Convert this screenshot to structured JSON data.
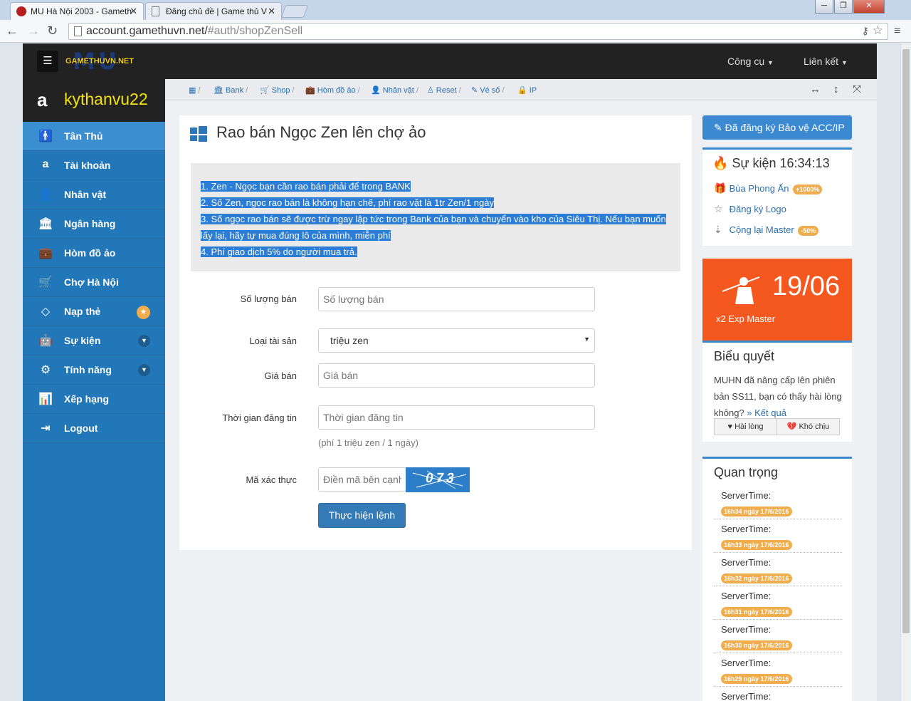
{
  "browser": {
    "tabs": [
      {
        "title": "MU Hà Nội 2003 - Gameth",
        "active": true
      },
      {
        "title": "Đăng chủ đề | Game thủ V",
        "active": false
      }
    ],
    "url_main": "account.gamethuvn.net/",
    "url_rest": "#auth/shopZenSell",
    "window_buttons": [
      "─",
      "❐",
      "✕"
    ]
  },
  "header": {
    "logo_big": "MU",
    "logo_small": "GAMETHUVN.NET",
    "menu": [
      "Công cụ",
      "Liên kết"
    ]
  },
  "user": {
    "name": "kythanvu22"
  },
  "sidebar": {
    "items": [
      {
        "label": "Tân Thủ",
        "icon": "child-icon",
        "glyph": "🚹"
      },
      {
        "label": "Tài khoản",
        "icon": "amazon-icon",
        "glyph": "a"
      },
      {
        "label": "Nhân vật",
        "icon": "user-icon",
        "glyph": "👤"
      },
      {
        "label": "Ngân hàng",
        "icon": "bank-icon",
        "glyph": "🏛"
      },
      {
        "label": "Hòm đồ ảo",
        "icon": "briefcase-icon",
        "glyph": "💼"
      },
      {
        "label": "Chợ Hà Nội",
        "icon": "cart-icon",
        "glyph": "🛒"
      },
      {
        "label": "Nạp thẻ",
        "icon": "diamond-icon",
        "glyph": "◇"
      },
      {
        "label": "Sự kiện",
        "icon": "android-icon",
        "glyph": "🤖"
      },
      {
        "label": "Tính năng",
        "icon": "cogs-icon",
        "glyph": "⚙"
      },
      {
        "label": "Xếp hạng",
        "icon": "bar-chart-icon",
        "glyph": "📊"
      },
      {
        "label": "Logout",
        "icon": "sign-out-icon",
        "glyph": "⇥"
      }
    ]
  },
  "breadcrumb": {
    "items": [
      "Bank",
      "Shop",
      "Hòm đồ ảo",
      "Nhân vật",
      "Reset",
      "Vé số",
      "IP"
    ]
  },
  "main": {
    "title": "Rao bán Ngọc Zen lên chợ ảo",
    "notice_lines": [
      "1. Zen - Ngọc bạn cần rao bán phải để trong BANK",
      "2. Số Zen, ngọc rao bán là không hạn chế, phí rao vặt là 1tr Zen/1 ngày",
      "3. Số ngọc rao bán sẽ được trừ ngay lập tức trong Bank của bạn và chuyển vào kho của Siêu Thị. Nếu bạn muốn",
      "lấy lại, hãy tự mua đúng lô của mình, miễn phí",
      "4. Phí giao dịch 5% do người mua trả."
    ],
    "form": {
      "qty_label": "Số lượng bán",
      "qty_placeholder": "Số lượng bán",
      "type_label": "Loại tài sản",
      "type_value": "triệu zen",
      "price_label": "Giá bán",
      "price_placeholder": "Giá bán",
      "time_label": "Thời gian đăng tin",
      "time_placeholder": "Thời gian đăng tin",
      "time_help": "(phí 1 triệu zen / 1 ngày)",
      "captcha_label": "Mã xác thực",
      "captcha_placeholder": "Điền mã bên cạnh",
      "captcha_text": "073",
      "submit": "Thực hiện lệnh"
    }
  },
  "right": {
    "register_button": "Đã đăng ký Bảo vệ ACC/IP",
    "events": {
      "title": "Sự kiện 16:34:13",
      "items": [
        {
          "label": "Bùa Phong Ấn",
          "badge": "+1000%"
        },
        {
          "label": "Đăng ký Logo",
          "badge": ""
        },
        {
          "label": "Cộng lại Master",
          "badge": "-50%"
        }
      ]
    },
    "promo": {
      "date": "19/06",
      "caption": "x2 Exp Master"
    },
    "poll": {
      "title": "Biểu quyết",
      "text": "MUHN đã nâng cấp lên phiên bản SS11, bạn có thấy hài lòng không?",
      "result_link": "» Kết quả",
      "options": [
        "Hài lòng",
        "Khó chịu"
      ]
    },
    "important": {
      "title": "Quan trọng",
      "label": "ServerTime:",
      "times": [
        "16h34 ngày 17/6/2016",
        "16h33 ngày 17/6/2016",
        "16h32 ngày 17/6/2016",
        "16h31 ngày 17/6/2016",
        "16h30 ngày 17/6/2016",
        "16h29 ngày 17/6/2016"
      ]
    }
  },
  "colors": {
    "accent": "#3b8ad1",
    "sidebar": "#2277b8",
    "promo": "#f4581f",
    "badge": "#f0ad4e"
  }
}
